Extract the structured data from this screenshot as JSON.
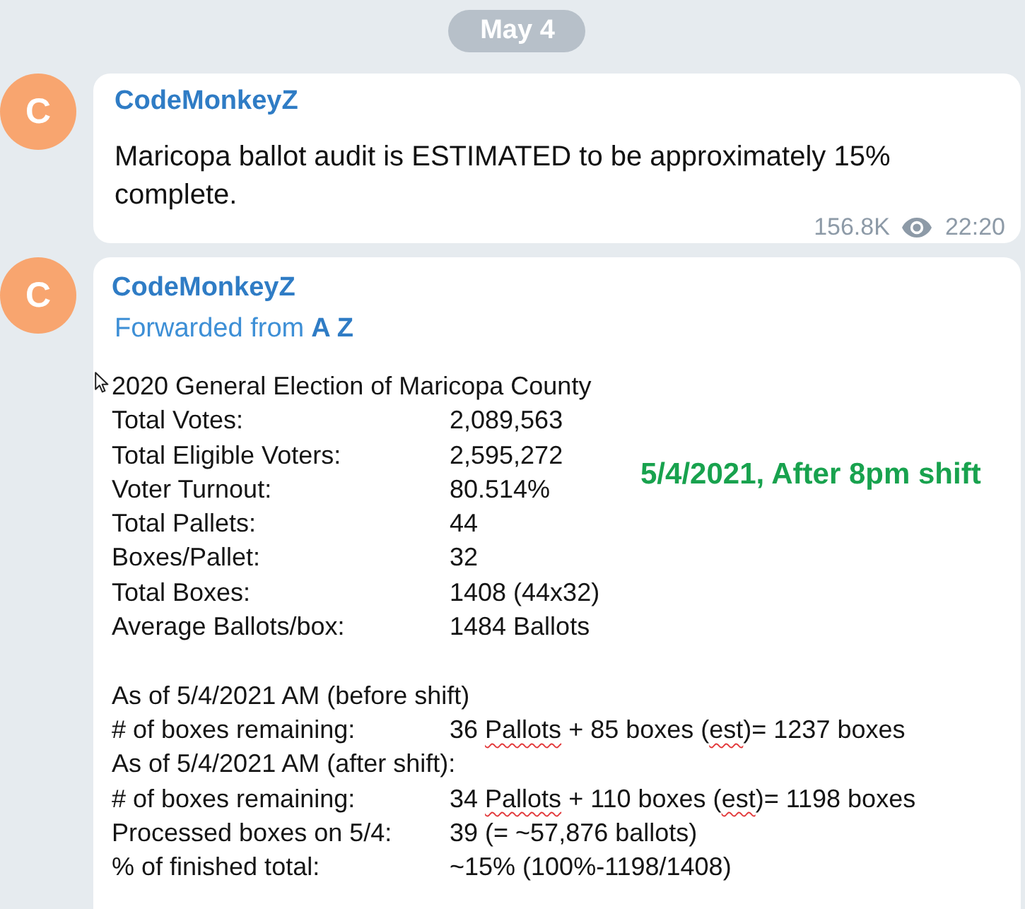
{
  "date_badge": "May 4",
  "messages": [
    {
      "kind": "text",
      "avatar": "C",
      "author": "CodeMonkeyZ",
      "text": "Maricopa ballot audit is ESTIMATED to be approximately 15% complete.",
      "views": "156.8K",
      "time": "22:20"
    },
    {
      "kind": "forwarded_document",
      "avatar": "C",
      "author": "CodeMonkeyZ",
      "forwarded": {
        "label": "Forwarded from",
        "author": "A Z"
      },
      "document": {
        "title": "2020 General Election of Maricopa County",
        "note": "5/4/2021, After 8pm shift",
        "sections": [
          {
            "rows": [
              {
                "kind": "pair",
                "label": "Total Votes:",
                "value": "2,089,563"
              },
              {
                "kind": "pair",
                "label": "Total Eligible Voters:",
                "value": "2,595,272"
              },
              {
                "kind": "pair",
                "label": "Voter Turnout:",
                "value": "80.514%"
              },
              {
                "kind": "pair",
                "label": "Total Pallets:",
                "value": "44"
              },
              {
                "kind": "pair",
                "label": "Boxes/Pallet:",
                "value": "32"
              },
              {
                "kind": "pair",
                "label": "Total Boxes:",
                "value": "1408 (44x32)"
              },
              {
                "kind": "pair",
                "label": "Average Ballots/box:",
                "value": "1484 Ballots"
              }
            ]
          },
          {
            "rows": [
              {
                "kind": "heading",
                "text": "As of 5/4/2021 AM (before shift)"
              },
              {
                "kind": "pair",
                "label": "# of boxes remaining:",
                "value": [
                  {
                    "text": "36 ",
                    "misspelled": false
                  },
                  {
                    "text": "Pallots",
                    "misspelled": true
                  },
                  {
                    "text": " + 85 boxes (",
                    "misspelled": false
                  },
                  {
                    "text": "est",
                    "misspelled": true
                  },
                  {
                    "text": ")= 1237 boxes",
                    "misspelled": false
                  }
                ]
              },
              {
                "kind": "heading",
                "text": "As of 5/4/2021 AM (after shift):"
              },
              {
                "kind": "pair",
                "label": "# of boxes remaining:",
                "value": [
                  {
                    "text": "34 ",
                    "misspelled": false
                  },
                  {
                    "text": "Pallots",
                    "misspelled": true
                  },
                  {
                    "text": " + 110 boxes (",
                    "misspelled": false
                  },
                  {
                    "text": "est",
                    "misspelled": true
                  },
                  {
                    "text": ")= 1198 boxes",
                    "misspelled": false
                  }
                ]
              },
              {
                "kind": "pair",
                "label": "Processed boxes on 5/4:",
                "value": "39 (= ~57,876 ballots)"
              },
              {
                "kind": "pair",
                "label": "% of finished total:",
                "value": "~15% (100%-1198/1408)"
              }
            ]
          }
        ]
      }
    }
  ]
}
